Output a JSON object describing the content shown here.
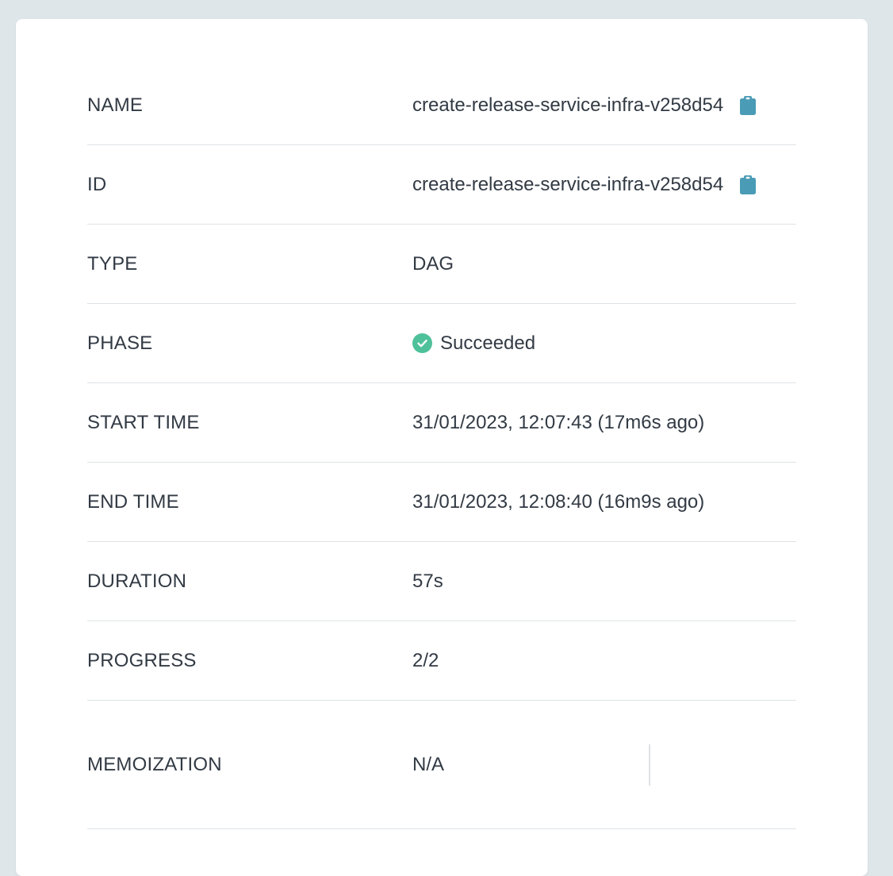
{
  "colors": {
    "background": "#dee6ea",
    "card": "#ffffff",
    "text": "#323a44",
    "divider": "#dfe3e6",
    "copy_icon": "#4a9bb5",
    "success": "#4ec19a"
  },
  "fields": {
    "name": {
      "label": "NAME",
      "value": "create-release-service-infra-v258d54",
      "icon": "clipboard-icon"
    },
    "id": {
      "label": "ID",
      "value": "create-release-service-infra-v258d54",
      "icon": "clipboard-icon"
    },
    "type": {
      "label": "TYPE",
      "value": "DAG"
    },
    "phase": {
      "label": "PHASE",
      "value": "Succeeded",
      "icon": "check-circle-icon"
    },
    "start_time": {
      "label": "START TIME",
      "value": "31/01/2023, 12:07:43 (17m6s ago)"
    },
    "end_time": {
      "label": "END TIME",
      "value": "31/01/2023, 12:08:40 (16m9s ago)"
    },
    "duration": {
      "label": "DURATION",
      "value": "57s"
    },
    "progress": {
      "label": "PROGRESS",
      "value": "2/2"
    },
    "memoization": {
      "label": "MEMOIZATION",
      "value": "N/A"
    }
  }
}
